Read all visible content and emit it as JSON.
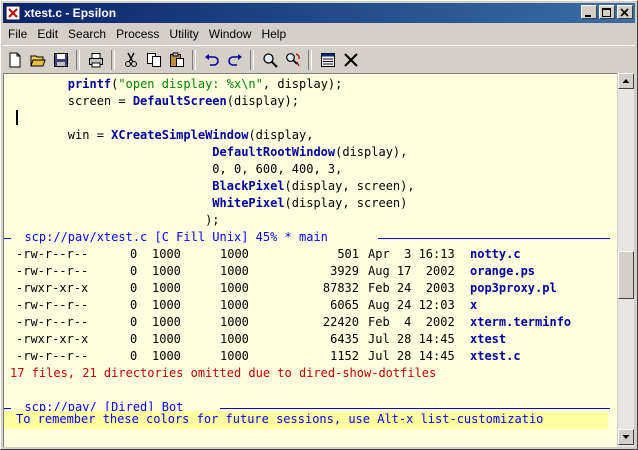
{
  "window": {
    "title": "xtest.c - Epsilon"
  },
  "menu": [
    "File",
    "Edit",
    "Search",
    "Process",
    "Utility",
    "Window",
    "Help"
  ],
  "toolbar": [
    "new-file-icon",
    "open-folder-icon",
    "save-icon",
    "print-icon",
    "cut-icon",
    "copy-icon",
    "paste-icon",
    "undo-icon",
    "redo-icon",
    "find-icon",
    "replace-icon",
    "buffer-list-icon",
    "close-icon"
  ],
  "code": {
    "l1_fn": "printf",
    "l1_open": "(",
    "l1_str": "\"open display: %x\\n\"",
    "l1_rest": ", display);",
    "l2_a": "screen = ",
    "l2_fn": "DefaultScreen",
    "l2_rest": "(display);",
    "l4_a": "win = ",
    "l4_fn": "XCreateSimpleWindow",
    "l4_rest": "(display,",
    "l5_fn": "DefaultRootWindow",
    "l5_rest": "(display),",
    "l6": "0, 0, 600, 400, 3,",
    "l7_fn": "BlackPixel",
    "l7_rest": "(display, screen),",
    "l8_fn": "WhitePixel",
    "l8_rest": "(display, screen)",
    "l9": ");"
  },
  "modeline1": "scp://pav/xtest.c [C Fill Unix] 45% * main",
  "dired": [
    {
      "perm": "-rw-r--r--",
      "links": "0",
      "uid": "1000",
      "gid": "1000",
      "size": "501",
      "date": "Apr  3 16:13",
      "name": "notty.c"
    },
    {
      "perm": "-rw-r--r--",
      "links": "0",
      "uid": "1000",
      "gid": "1000",
      "size": "3929",
      "date": "Aug 17  2002",
      "name": "orange.ps"
    },
    {
      "perm": "-rwxr-xr-x",
      "links": "0",
      "uid": "1000",
      "gid": "1000",
      "size": "87832",
      "date": "Feb 24  2003",
      "name": "pop3proxy.pl"
    },
    {
      "perm": "-rw-r--r--",
      "links": "0",
      "uid": "1000",
      "gid": "1000",
      "size": "6065",
      "date": "Aug 24 12:03",
      "name": "x"
    },
    {
      "perm": "-rw-r--r--",
      "links": "0",
      "uid": "1000",
      "gid": "1000",
      "size": "22420",
      "date": "Feb  4  2002",
      "name": "xterm.terminfo"
    },
    {
      "perm": "-rwxr-xr-x",
      "links": "0",
      "uid": "1000",
      "gid": "1000",
      "size": "6435",
      "date": "Jul 28 14:45",
      "name": "xtest"
    },
    {
      "perm": "-rw-r--r--",
      "links": "0",
      "uid": "1000",
      "gid": "1000",
      "size": "1152",
      "date": "Jul 28 14:45",
      "name": "xtest.c"
    }
  ],
  "dired_note": "17 files, 21 directories omitted due to dired-show-dotfiles",
  "modeline2": "scp://pav/ [Dired] Bot",
  "echo": "To remember these colors for future sessions, use Alt-x list-customizatio"
}
